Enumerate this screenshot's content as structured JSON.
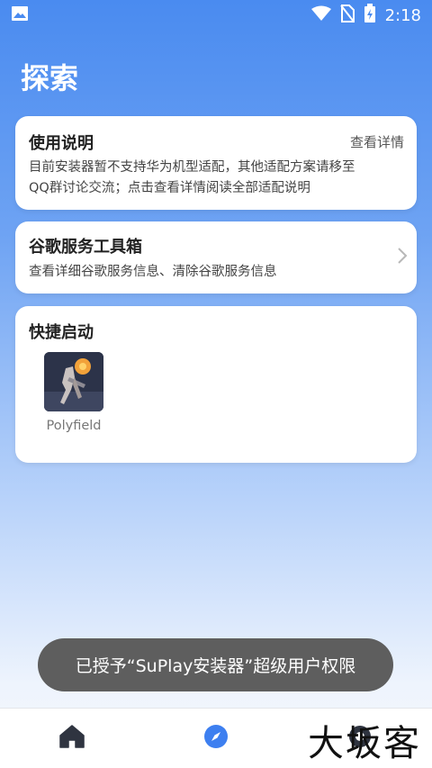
{
  "status_bar": {
    "time": "2:18",
    "icons": [
      "image-icon",
      "wifi-icon",
      "no-sim-icon",
      "battery-charging-icon"
    ]
  },
  "page": {
    "title": "探索"
  },
  "usage_card": {
    "title": "使用说明",
    "link": "查看详情",
    "line1": "目前安装器暂不支持华为机型适配，其他适配方案请移至",
    "line2": "QQ群讨论交流；点击查看详情阅读全部适配说明"
  },
  "google_card": {
    "title": "谷歌服务工具箱",
    "desc": "查看详细谷歌服务信息、清除谷歌服务信息"
  },
  "quick_card": {
    "title": "快捷启动",
    "apps": [
      {
        "label": "Polyfield",
        "icon": "polyfield-app-icon"
      }
    ]
  },
  "toast": {
    "text": "已授予“SuPlay安装器”超级用户权限"
  },
  "bottom_nav": {
    "items": [
      {
        "icon": "home-icon",
        "active": false
      },
      {
        "icon": "compass-icon",
        "active": true
      },
      {
        "icon": "profile-icon",
        "active": false
      }
    ]
  },
  "watermark": {
    "text": "大坂客"
  },
  "colors": {
    "accent": "#4a8bf0",
    "toast_bg": "#5e5e5e",
    "nav_icon": "#2f3440"
  }
}
